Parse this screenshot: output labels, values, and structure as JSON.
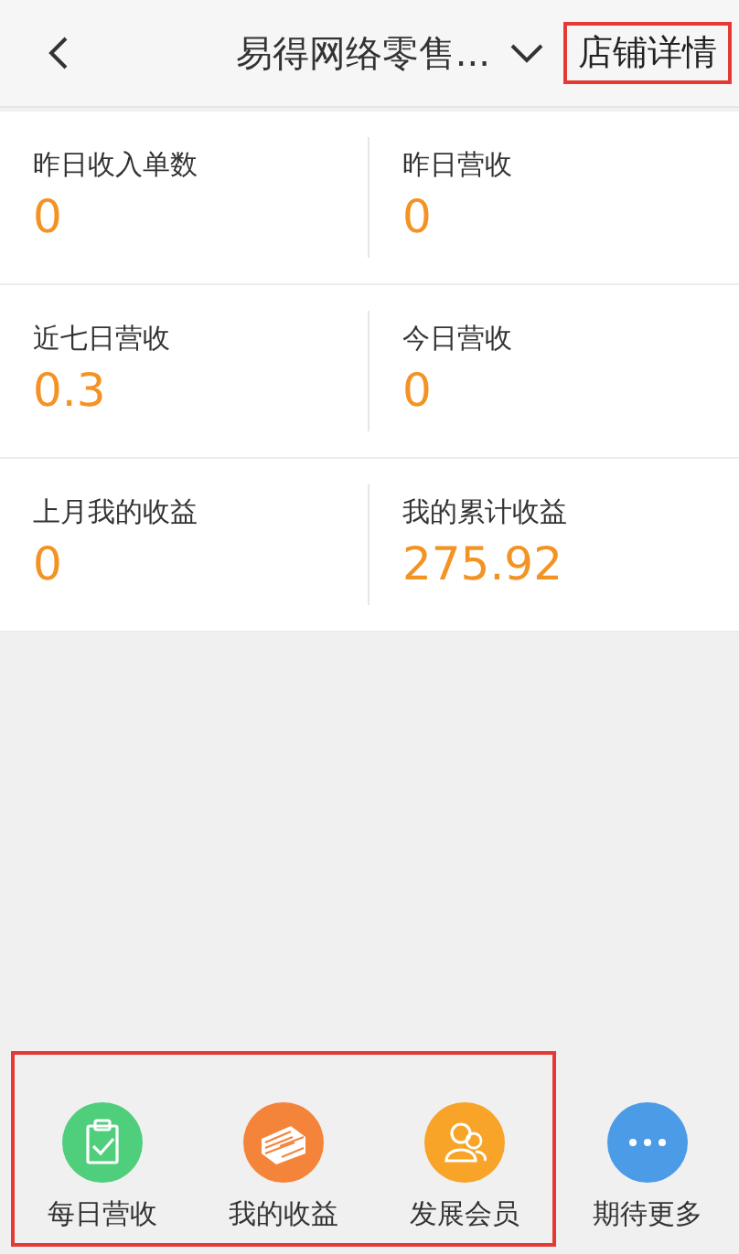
{
  "header": {
    "title": "易得网络零售...",
    "store_detail_button": {
      "label": "店铺详情",
      "highlighted": true
    }
  },
  "stats": [
    {
      "label": "昨日收入单数",
      "value": "0"
    },
    {
      "label": "昨日营收",
      "value": "0"
    },
    {
      "label": "近七日营收",
      "value": "0.3"
    },
    {
      "label": "今日营收",
      "value": "0"
    },
    {
      "label": "上月我的收益",
      "value": "0"
    },
    {
      "label": "我的累计收益",
      "value": "275.92"
    }
  ],
  "actions": [
    {
      "kind": "clipboard",
      "label": "每日营收",
      "color": "#4fce7c",
      "highlighted": true
    },
    {
      "kind": "money",
      "label": "我的收益",
      "color": "#f5843b",
      "highlighted": true
    },
    {
      "kind": "members",
      "label": "发展会员",
      "color": "#f7a428",
      "highlighted": true
    },
    {
      "kind": "more",
      "label": "期待更多",
      "color": "#4b9be6",
      "highlighted": false
    }
  ]
}
